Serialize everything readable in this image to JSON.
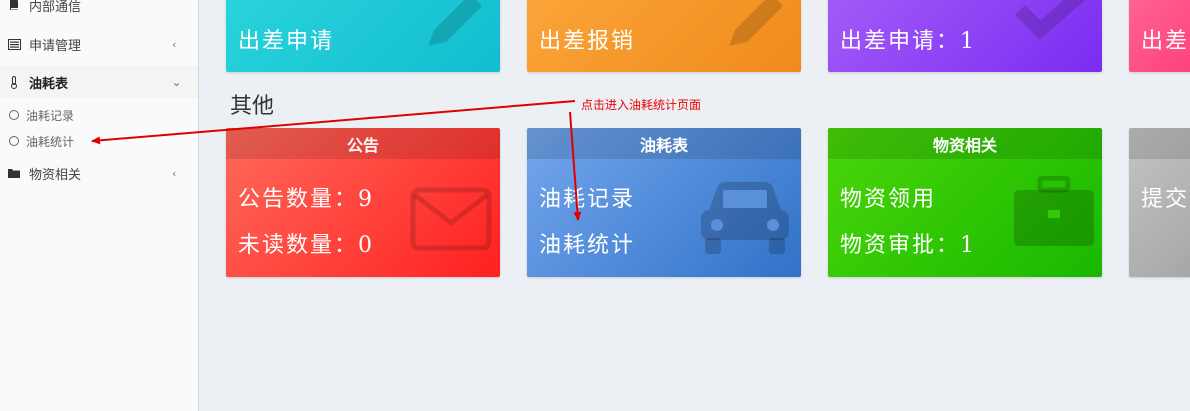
{
  "sidebar": {
    "items": [
      {
        "label": "内部通信",
        "icon": "book-icon"
      },
      {
        "label": "申请管理",
        "icon": "list-icon",
        "chevron": "‹"
      },
      {
        "label": "油耗表",
        "icon": "thermometer-icon",
        "chevron": "⌄"
      },
      {
        "label": "物资相关",
        "icon": "folder-icon",
        "chevron": "‹"
      }
    ],
    "sub_items": [
      {
        "label": "油耗记录"
      },
      {
        "label": "油耗统计"
      }
    ]
  },
  "top_cards": [
    {
      "text": "出差申请",
      "color": "#1cc7d0"
    },
    {
      "text": "出差报销",
      "color": "#f7982a"
    },
    {
      "text": "出差申请：1",
      "color": "#8a3cf5"
    },
    {
      "text": "出差",
      "color": "#ff4f86"
    }
  ],
  "section_title": "其他",
  "cards": [
    {
      "header": "公告",
      "line1": "公告数量：9",
      "line2": "未读数量：0"
    },
    {
      "header": "油耗表",
      "line1": "油耗记录",
      "line2": "油耗统计"
    },
    {
      "header": "物资相关",
      "line1": "物资领用",
      "line2": "物资审批：1"
    },
    {
      "header": "",
      "line1": "提交",
      "line2": ""
    }
  ],
  "annotation": "点击进入油耗统计页面",
  "colors": {
    "annotation": "#e00000",
    "notice_card": "#ff4040",
    "fuel_card": "#4a8ae0",
    "material_card": "#2ecc00",
    "submit_card": "#b4b4b4"
  }
}
